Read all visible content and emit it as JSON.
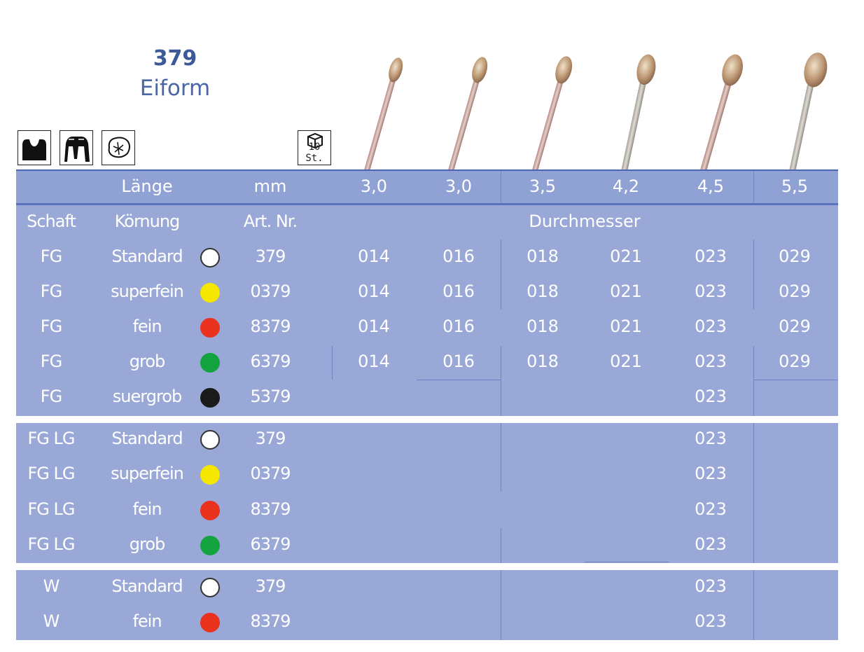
{
  "header": {
    "number": "379",
    "name": "Eiform"
  },
  "icons": [
    {
      "name": "crown-prep-icon"
    },
    {
      "name": "tooth-crown-icon"
    },
    {
      "name": "occlusal-surface-icon"
    }
  ],
  "pack": {
    "label": "10 St.",
    "icon": "box-icon"
  },
  "table": {
    "header_row": {
      "c1": "Länge",
      "c2": "mm",
      "lengths": [
        "3,0",
        "3,0",
        "3,5",
        "4,2",
        "4,5",
        "5,5"
      ]
    },
    "label_row": {
      "schaft": "Schaft",
      "koernung": "Körnung",
      "art": "Art. Nr.",
      "durchmesser": "Durchmesser"
    },
    "groups": [
      {
        "rows": [
          {
            "schaft": "FG",
            "koernung": "Standard",
            "color": "#ffffff",
            "ring": "#333333",
            "art": "379",
            "sizes": [
              "014",
              "016",
              "018",
              "021",
              "023",
              "029"
            ]
          },
          {
            "schaft": "FG",
            "koernung": "superfein",
            "color": "#f5e600",
            "ring": "#f5e600",
            "art": "0379",
            "sizes": [
              "014",
              "016",
              "018",
              "021",
              "023",
              "029"
            ]
          },
          {
            "schaft": "FG",
            "koernung": "fein",
            "color": "#e8321e",
            "ring": "#e8321e",
            "art": "8379",
            "sizes": [
              "014",
              "016",
              "018",
              "021",
              "023",
              "029"
            ]
          },
          {
            "schaft": "FG",
            "koernung": "grob",
            "color": "#13a33f",
            "ring": "#13a33f",
            "art": "6379",
            "sizes": [
              "014",
              "016",
              "018",
              "021",
              "023",
              "029"
            ]
          },
          {
            "schaft": "FG",
            "koernung": "suergrob",
            "color": "#1b1b1b",
            "ring": "#1b1b1b",
            "art": "5379",
            "sizes": [
              "",
              "",
              "",
              "",
              "023",
              ""
            ]
          }
        ]
      },
      {
        "rows": [
          {
            "schaft": "FG LG",
            "koernung": "Standard",
            "color": "#ffffff",
            "ring": "#333333",
            "art": "379",
            "sizes": [
              "",
              "",
              "",
              "",
              "023",
              ""
            ]
          },
          {
            "schaft": "FG LG",
            "koernung": "superfein",
            "color": "#f5e600",
            "ring": "#f5e600",
            "art": "0379",
            "sizes": [
              "",
              "",
              "",
              "",
              "023",
              ""
            ]
          },
          {
            "schaft": "FG LG",
            "koernung": "fein",
            "color": "#e8321e",
            "ring": "#e8321e",
            "art": "8379",
            "sizes": [
              "",
              "",
              "",
              "",
              "023",
              ""
            ]
          },
          {
            "schaft": "FG LG",
            "koernung": "grob",
            "color": "#13a33f",
            "ring": "#13a33f",
            "art": "6379",
            "sizes": [
              "",
              "",
              "",
              "",
              "023",
              ""
            ]
          }
        ]
      },
      {
        "rows": [
          {
            "schaft": "W",
            "koernung": "Standard",
            "color": "#ffffff",
            "ring": "#333333",
            "art": "379",
            "sizes": [
              "",
              "",
              "",
              "",
              "023",
              ""
            ]
          },
          {
            "schaft": "W",
            "koernung": "fein",
            "color": "#e8321e",
            "ring": "#e8321e",
            "art": "8379",
            "sizes": [
              "",
              "",
              "",
              "",
              "023",
              ""
            ]
          }
        ]
      }
    ]
  }
}
